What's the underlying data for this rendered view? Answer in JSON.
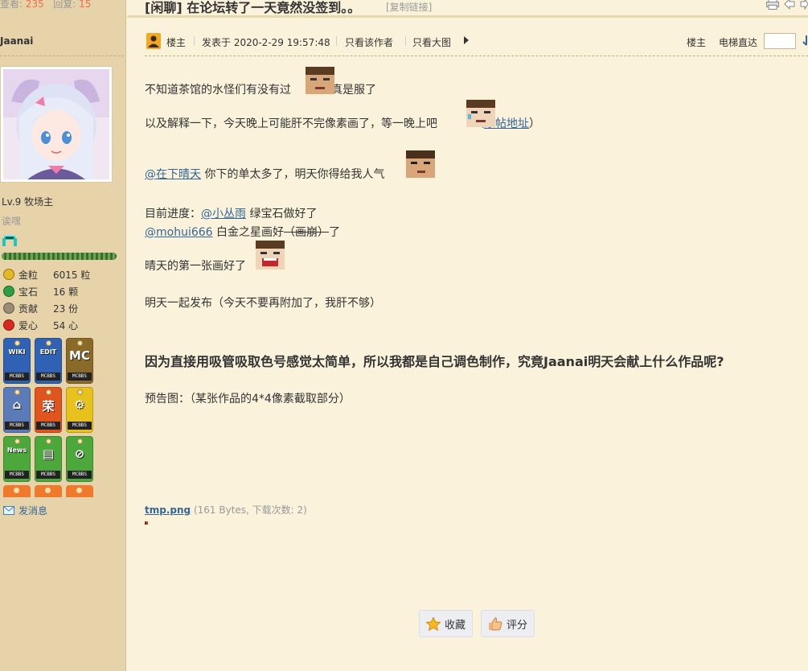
{
  "topstats": {
    "views_label": "查看:",
    "views": "235",
    "replies_label": "回复:",
    "replies": "15"
  },
  "user": {
    "name": "Jaanai",
    "level": "Lv.9 牧场主",
    "title": "诶嘿",
    "exp_fraction": 1.0,
    "stats": [
      {
        "icon": "gold-nugget-icon",
        "label": "金粒",
        "value": "6015 粒",
        "color": "#e6b820"
      },
      {
        "icon": "emerald-icon",
        "label": "宝石",
        "value": "16 颗",
        "color": "#2e9e44"
      },
      {
        "icon": "contribution-icon",
        "label": "贡献",
        "value": "23 份",
        "color": "#9b8c78"
      },
      {
        "icon": "apple-icon",
        "label": "爱心",
        "value": "54 心",
        "color": "#d62a1f"
      }
    ],
    "medals": [
      {
        "glyph": "WIKI",
        "tag": "MCBBS",
        "color": "#2f62b5"
      },
      {
        "glyph": "EDIT",
        "tag": "MCBBS",
        "color": "#2f62b5"
      },
      {
        "glyph": "MC",
        "tag": "MCBBS",
        "color": "#8a6a28"
      },
      {
        "glyph": "⌂",
        "tag": "MCBBS",
        "color": "#5a7ab8"
      },
      {
        "glyph": "荣",
        "tag": "MCBBS",
        "color": "#e0541e"
      },
      {
        "glyph": "⚙",
        "tag": "MCBBS",
        "color": "#e7c21c"
      },
      {
        "glyph": "News",
        "tag": "MCBBS",
        "color": "#4ca83a"
      },
      {
        "glyph": "▤",
        "tag": "MCBBS",
        "color": "#4ca83a"
      },
      {
        "glyph": "⊘",
        "tag": "MCBBS",
        "color": "#4ca83a"
      }
    ],
    "send_message": "发消息"
  },
  "thread": {
    "title": "[闲聊] 在论坛转了一天竟然没签到。。",
    "copy_link": "[复制链接]"
  },
  "post_bar": {
    "author_badge": "楼主",
    "posted_at": "发表于 2020-2-29 19:57:48",
    "only_author": "只看该作者",
    "big_images": "只看大图",
    "floor": "楼主",
    "jump_label": "电梯直达"
  },
  "post": {
    "line1": "不知道茶馆的水怪们有没有过",
    "line1b": "我真是服了",
    "line2": "以及解释一下，今天晚上可能肝不完像素画了，等一晚上吧",
    "line2_paren_open": "（",
    "line2_link": "原帖地址",
    "line2_paren_close": "）",
    "mention1": "@在下晴天",
    "line3": " 你下的单太多了，明天你得给我人气",
    "progress_label": "目前进度：",
    "mention2": "@小丛雨",
    "progress1": " 绿宝石做好了",
    "mention3": "@mohui666",
    "progress2a": " 白金之星画好",
    "progress2_strike": "（画崩）",
    "progress2b": "了",
    "line5": "晴天的第一张画好了",
    "line6": "明天一起发布（今天不要再附加了，我肝不够）",
    "big_question": "因为直接用吸管吸取色号感觉太简单，所以我都是自己调色制作，究竟Jaanai明天会献上什么作品呢?",
    "preview": "预告图：（某张作品的4*4像素截取部分）"
  },
  "attachment": {
    "name": "tmp.png",
    "meta": "(161 Bytes, 下载次数: 2)"
  },
  "actions": {
    "favorite": "收藏",
    "rate": "评分"
  }
}
